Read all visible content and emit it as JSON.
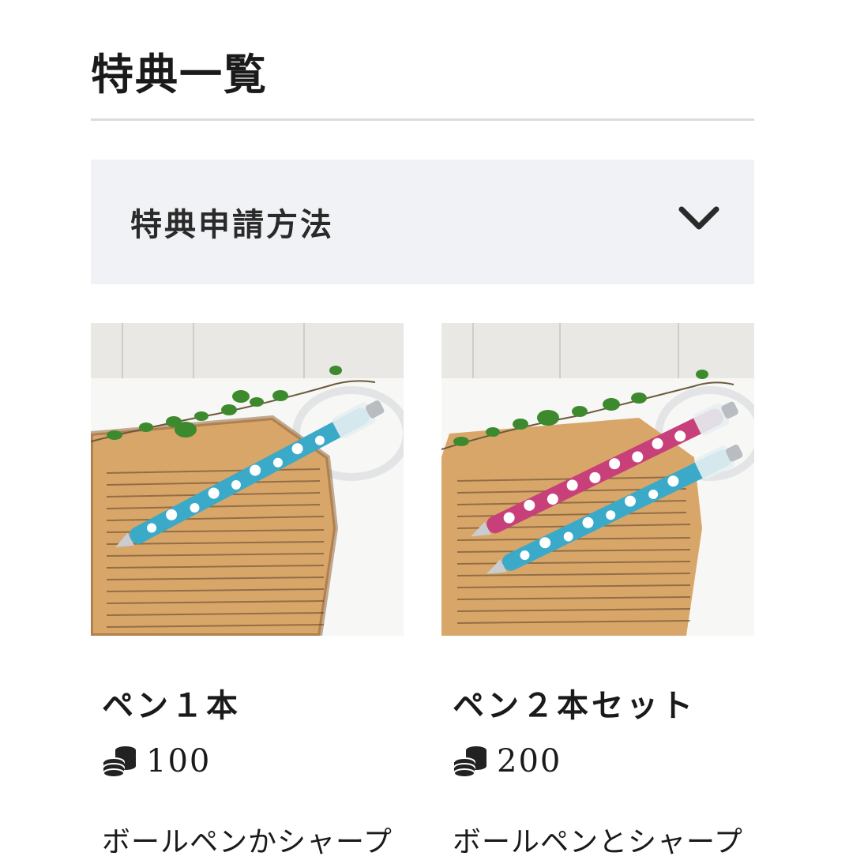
{
  "page": {
    "title": "特典一覧"
  },
  "accordion": {
    "label": "特典申請方法",
    "icon": "chevron-down-icon"
  },
  "rewards": [
    {
      "title": "ペン１本",
      "points_icon": "coins-icon",
      "points": "100",
      "description": "ボールペンかシャープ"
    },
    {
      "title": "ペン２本セット",
      "points_icon": "coins-icon",
      "points": "200",
      "description": "ボールペンとシャープ"
    }
  ],
  "colors": {
    "accordion_bg": "#f1f2f5",
    "divider": "#dcdcdc",
    "text": "#1a1a1a"
  }
}
